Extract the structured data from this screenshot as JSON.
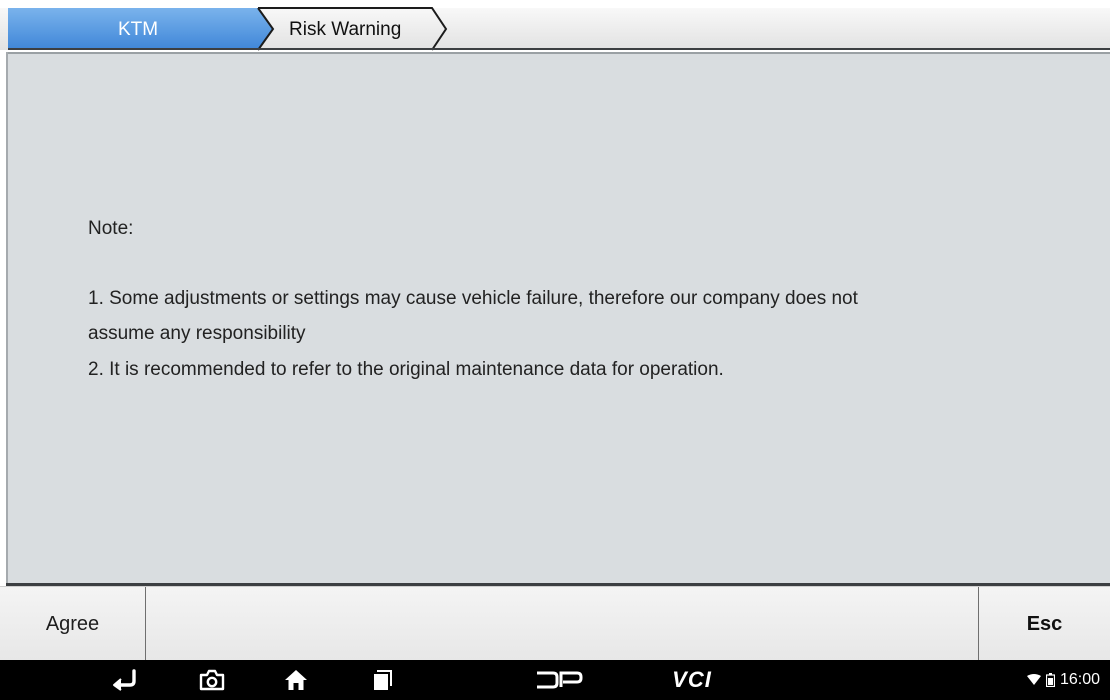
{
  "breadcrumb": {
    "items": [
      {
        "label": "KTM"
      },
      {
        "label": "Risk Warning"
      }
    ]
  },
  "note": {
    "title": "Note:",
    "lines": [
      "1. Some adjustments or settings may cause vehicle failure,  therefore our company does not",
      "assume any responsibility",
      "2. It is recommended to refer to the original maintenance data for operation."
    ]
  },
  "actions": {
    "agree_label": "Agree",
    "esc_label": "Esc"
  },
  "navbar": {
    "icons": [
      "back-icon",
      "camera-icon",
      "home-icon",
      "recent-apps-icon",
      "dp-logo-icon",
      "vci-icon"
    ],
    "vci_label": "VCI",
    "status": {
      "time": "16:00",
      "icons": [
        "wifi-icon",
        "battery-icon"
      ]
    }
  },
  "colors": {
    "accent_blue": "#4a90dc",
    "panel_bg": "#d9dde0",
    "navbar_bg": "#000000"
  }
}
